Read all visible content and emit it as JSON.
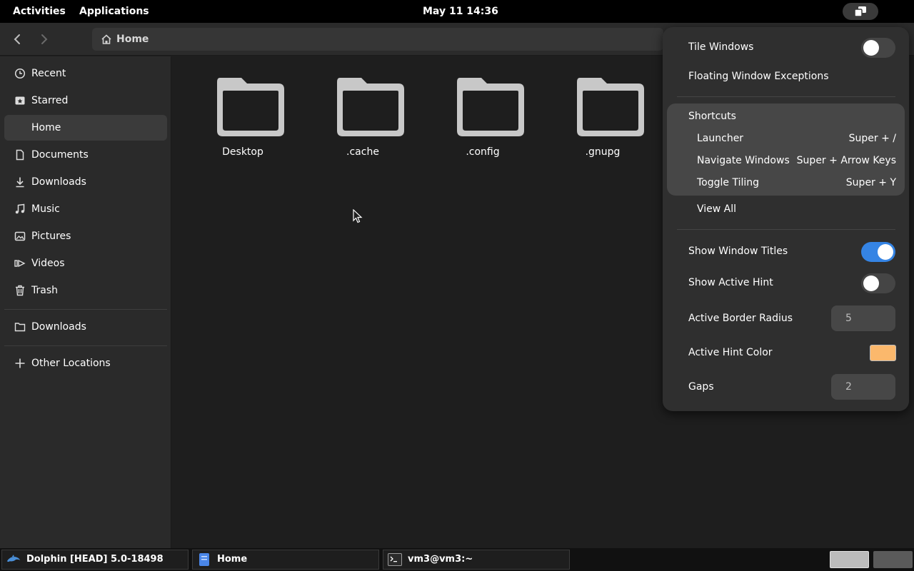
{
  "topbar": {
    "activities": "Activities",
    "applications": "Applications",
    "clock": "May 11  14:36",
    "tray_icon": "window-tiling-icon"
  },
  "header": {
    "path": "Home",
    "back_icon": "chevron-left-icon",
    "forward_icon": "chevron-right-icon",
    "home_icon": "home-icon"
  },
  "sidebar": {
    "items": [
      {
        "label": "Recent",
        "icon": "clock-icon"
      },
      {
        "label": "Starred",
        "icon": "star-icon"
      },
      {
        "label": "Home",
        "icon": "home-icon"
      },
      {
        "label": "Documents",
        "icon": "document-icon"
      },
      {
        "label": "Downloads",
        "icon": "download-icon"
      },
      {
        "label": "Music",
        "icon": "music-icon"
      },
      {
        "label": "Pictures",
        "icon": "picture-icon"
      },
      {
        "label": "Videos",
        "icon": "video-icon"
      },
      {
        "label": "Trash",
        "icon": "trash-icon"
      }
    ],
    "bookmarks": [
      {
        "label": "Downloads",
        "icon": "folder-icon"
      }
    ],
    "other_locations": "Other Locations",
    "active": "Home"
  },
  "main": {
    "folders": [
      "Desktop",
      ".cache",
      ".config",
      ".gnupg"
    ]
  },
  "menu": {
    "tile_windows": {
      "label": "Tile Windows",
      "on": false
    },
    "floating_exceptions": "Floating Window Exceptions",
    "shortcuts_header": "Shortcuts",
    "shortcuts": [
      {
        "action": "Launcher",
        "keys": "Super + /"
      },
      {
        "action": "Navigate Windows",
        "keys": "Super + Arrow Keys"
      },
      {
        "action": "Toggle Tiling",
        "keys": "Super + Y"
      }
    ],
    "view_all": "View All",
    "show_window_titles": {
      "label": "Show Window Titles",
      "on": true
    },
    "show_active_hint": {
      "label": "Show Active Hint",
      "on": false
    },
    "active_border_radius": {
      "label": "Active Border Radius",
      "value": "5"
    },
    "active_hint_color": {
      "label": "Active Hint Color",
      "color": "#fbb86c"
    },
    "gaps": {
      "label": "Gaps",
      "value": "2"
    }
  },
  "taskbar": {
    "tasks": [
      {
        "label": "Dolphin [HEAD] 5.0-18498",
        "icon": "dolphin-icon"
      },
      {
        "label": "Home",
        "icon": "files-icon"
      },
      {
        "label": "vm3@vm3:~",
        "icon": "terminal-icon"
      }
    ],
    "workspaces": 2,
    "active_workspace": 1
  },
  "colors": {
    "accent": "#3584e4",
    "hint": "#fbb86c"
  }
}
